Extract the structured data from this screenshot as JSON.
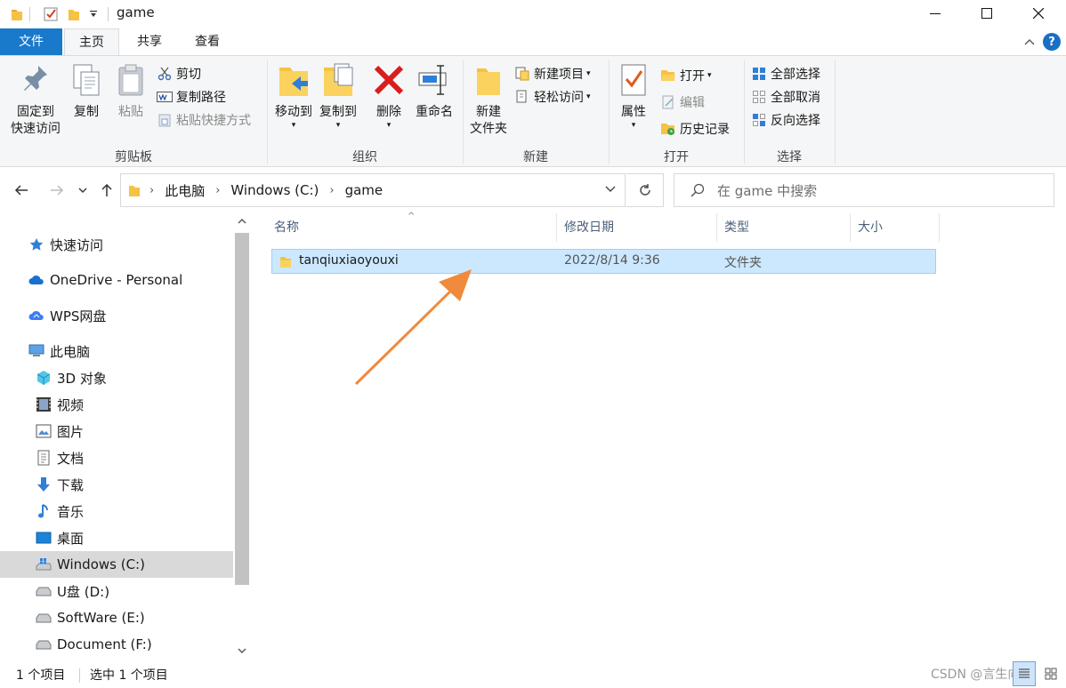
{
  "window": {
    "title": "game",
    "minimize_icon": "minimize-icon",
    "maximize_icon": "maximize-icon",
    "close_icon": "close-icon"
  },
  "tabs": {
    "file": "文件",
    "home": "主页",
    "share": "共享",
    "view": "查看"
  },
  "ribbon": {
    "clipboard": {
      "label": "剪贴板",
      "pin": "固定到\n快速访问",
      "pin_line1": "固定到",
      "pin_line2": "快速访问",
      "copy": "复制",
      "paste": "粘贴",
      "cut": "剪切",
      "copy_path": "复制路径",
      "paste_shortcut": "粘贴快捷方式"
    },
    "organize": {
      "label": "组织",
      "move_to": "移动到",
      "copy_to": "复制到",
      "delete": "删除",
      "rename": "重命名"
    },
    "new": {
      "label": "新建",
      "new_folder_line1": "新建",
      "new_folder_line2": "文件夹",
      "new_item": "新建项目",
      "easy_access": "轻松访问"
    },
    "open": {
      "label": "打开",
      "properties": "属性",
      "open": "打开",
      "edit": "编辑",
      "history": "历史记录"
    },
    "select": {
      "label": "选择",
      "select_all": "全部选择",
      "select_none": "全部取消",
      "invert": "反向选择"
    }
  },
  "address": {
    "crumbs": [
      "此电脑",
      "Windows (C:)",
      "game"
    ],
    "search_placeholder": "在 game 中搜索"
  },
  "navpane": {
    "quick_access": "快速访问",
    "onedrive": "OneDrive - Personal",
    "wps": "WPS网盘",
    "this_pc": "此电脑",
    "items": [
      "3D 对象",
      "视频",
      "图片",
      "文档",
      "下载",
      "音乐",
      "桌面",
      "Windows (C:)",
      "U盘 (D:)",
      "SoftWare (E:)",
      "Document (F:)"
    ]
  },
  "columns": {
    "name": "名称",
    "modified": "修改日期",
    "type": "类型",
    "size": "大小"
  },
  "files": [
    {
      "name": "tanqiuxiaoyouxi",
      "modified": "2022/8/14 9:36",
      "type": "文件夹",
      "size": ""
    }
  ],
  "status": {
    "count": "1 个项目",
    "selected": "选中 1 个项目",
    "watermark": "CSDN @言生向吗"
  },
  "colors": {
    "accent": "#1979ca",
    "selection": "#cce8ff",
    "arrow": "#f08a3c"
  }
}
